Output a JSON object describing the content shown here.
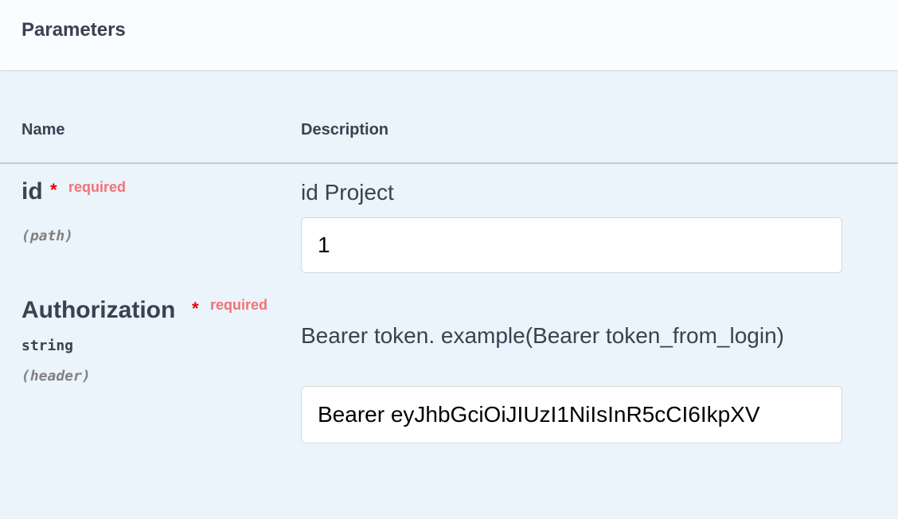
{
  "section": {
    "title": "Parameters"
  },
  "columns": {
    "name": "Name",
    "description": "Description"
  },
  "params": [
    {
      "name": "id",
      "required_star": "*",
      "required_label": "required",
      "type": "",
      "in": "(path)",
      "description": "id Project",
      "value": "1"
    },
    {
      "name": "Authorization",
      "required_star": "*",
      "required_label": "required",
      "type": "string",
      "in": "(header)",
      "description": "Bearer token. example(Bearer token_from_login)",
      "value": "Bearer eyJhbGciOiJIUzI1NiIsInR5cCI6IkpXV"
    }
  ]
}
